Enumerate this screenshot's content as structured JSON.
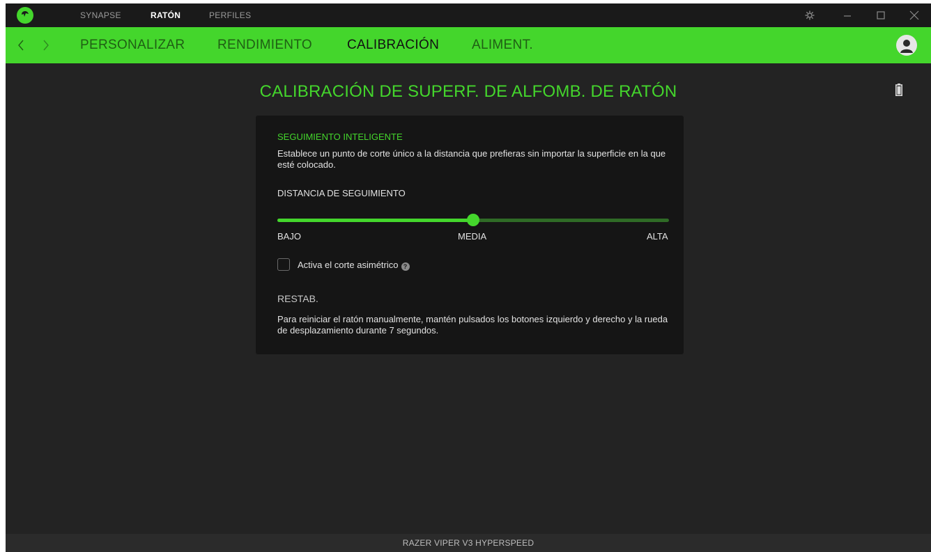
{
  "titlebar": {
    "tabs": [
      {
        "label": "SYNAPSE",
        "active": false
      },
      {
        "label": "RATÓN",
        "active": true
      },
      {
        "label": "PERFILES",
        "active": false
      }
    ],
    "icons": [
      "settings-icon",
      "minimize-icon",
      "maximize-icon",
      "close-icon"
    ]
  },
  "navbar": {
    "tabs": [
      {
        "label": "PERSONALIZAR",
        "active": false
      },
      {
        "label": "RENDIMIENTO",
        "active": false
      },
      {
        "label": "CALIBRACIÓN",
        "active": true
      },
      {
        "label": "ALIMENT.",
        "active": false
      }
    ]
  },
  "main": {
    "title": "CALIBRACIÓN DE SUPERF. DE ALFOMB. DE RATÓN",
    "panel": {
      "section_title": "SEGUIMIENTO INTELIGENTE",
      "description": "Establece un punto de corte único a la distancia que prefieras sin importar la superficie en la que esté colocado.",
      "distance_label": "DISTANCIA DE SEGUIMIENTO",
      "slider": {
        "value": 0.5,
        "low_label": "BAJO",
        "mid_label": "MEDIA",
        "high_label": "ALTA"
      },
      "asymmetric_checkbox": {
        "label": "Activa el corte asimétrico",
        "checked": false
      },
      "reset_title": "RESTAB.",
      "reset_description": "Para reiniciar el ratón manualmente, mantén pulsados los botones izquierdo y derecho y la rueda de desplazamiento durante 7 segundos."
    }
  },
  "footer": {
    "device_name": "RAZER VIPER V3 HYPERSPEED"
  },
  "colors": {
    "accent": "#44d62c",
    "background": "#232323",
    "panel": "#151515"
  }
}
